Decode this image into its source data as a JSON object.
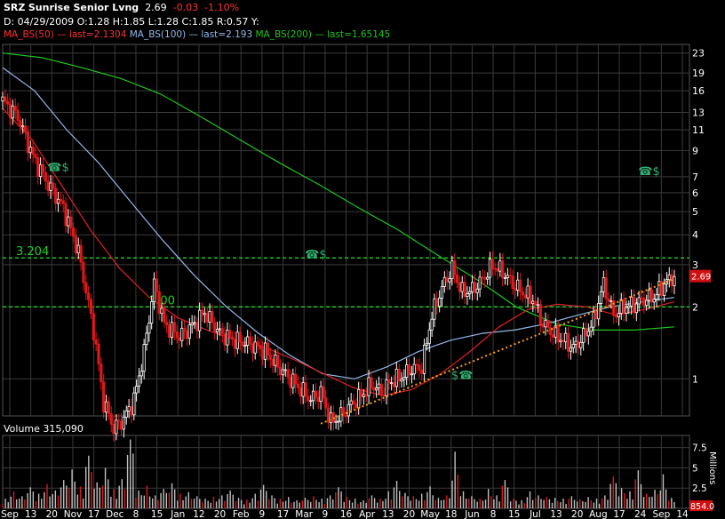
{
  "header": {
    "symbol": "SRZ",
    "company": "Sunrise Senior Lvng",
    "last": "2.69",
    "change": "-0.03",
    "change_pct": "-1.10%",
    "ohlc_line": "D: 04/29/2009 O:1.28 H:1.85 L:1.28 C:1.85 R:0.57 Y:",
    "ma50": {
      "label": "MA_BS(50)",
      "last": "last=2.1304",
      "color": "#e02020"
    },
    "ma100": {
      "label": "MA_BS(100)",
      "last": "last=2.193",
      "color": "#8fb8e8"
    },
    "ma200": {
      "label": "MA_BS(200)",
      "last": "last=1.65145",
      "color": "#1fc41f"
    }
  },
  "volume_label": "Volume 315,090",
  "millions_label": "Millions",
  "chart_data": {
    "type": "candlestick",
    "price_scale": "log",
    "price_ticks": [
      1,
      2,
      3,
      4,
      5,
      6,
      7,
      9,
      11,
      13,
      16,
      19,
      23
    ],
    "price_range": [
      0.7,
      25
    ],
    "x_ticks": [
      "Sep",
      "13",
      "20",
      "Nov",
      "17",
      "Dec",
      "8",
      "15",
      "Jan",
      "12",
      "20",
      "Feb",
      "9",
      "17",
      "Mar",
      "9",
      "16",
      "Apr",
      "13",
      "20",
      "May",
      "18",
      "Jun",
      "8",
      "15",
      "Jul",
      "13",
      "20",
      "Aug",
      "17",
      "24",
      "Sep",
      "14"
    ],
    "close_series": [
      {
        "t": 0,
        "p": 14.5
      },
      {
        "t": 3,
        "p": 12.5
      },
      {
        "t": 6,
        "p": 8.5
      },
      {
        "t": 9,
        "p": 6.5
      },
      {
        "t": 12,
        "p": 5.2
      },
      {
        "t": 15,
        "p": 3.4
      },
      {
        "t": 18,
        "p": 1.6
      },
      {
        "t": 20,
        "p": 0.8
      },
      {
        "t": 22,
        "p": 0.62
      },
      {
        "t": 24,
        "p": 0.68
      },
      {
        "t": 26,
        "p": 0.82
      },
      {
        "t": 28,
        "p": 1.3
      },
      {
        "t": 30,
        "p": 2.5
      },
      {
        "t": 32,
        "p": 1.7
      },
      {
        "t": 35,
        "p": 1.5
      },
      {
        "t": 38,
        "p": 1.7
      },
      {
        "t": 40,
        "p": 1.9
      },
      {
        "t": 43,
        "p": 1.55
      },
      {
        "t": 46,
        "p": 1.45
      },
      {
        "t": 49,
        "p": 1.4
      },
      {
        "t": 52,
        "p": 1.3
      },
      {
        "t": 55,
        "p": 1.1
      },
      {
        "t": 58,
        "p": 0.95
      },
      {
        "t": 61,
        "p": 0.82
      },
      {
        "t": 63,
        "p": 0.88
      },
      {
        "t": 65,
        "p": 0.66
      },
      {
        "t": 67,
        "p": 0.7
      },
      {
        "t": 69,
        "p": 0.78
      },
      {
        "t": 71,
        "p": 0.85
      },
      {
        "t": 73,
        "p": 0.95
      },
      {
        "t": 75,
        "p": 0.88
      },
      {
        "t": 77,
        "p": 0.98
      },
      {
        "t": 79,
        "p": 1.02
      },
      {
        "t": 81,
        "p": 1.1
      },
      {
        "t": 83,
        "p": 1.12
      },
      {
        "t": 85,
        "p": 1.85
      },
      {
        "t": 87,
        "p": 2.4
      },
      {
        "t": 89,
        "p": 2.9
      },
      {
        "t": 91,
        "p": 2.3
      },
      {
        "t": 93,
        "p": 2.35
      },
      {
        "t": 95,
        "p": 2.6
      },
      {
        "t": 97,
        "p": 3.0
      },
      {
        "t": 99,
        "p": 2.8
      },
      {
        "t": 101,
        "p": 2.5
      },
      {
        "t": 103,
        "p": 2.3
      },
      {
        "t": 105,
        "p": 2.15
      },
      {
        "t": 107,
        "p": 1.7
      },
      {
        "t": 109,
        "p": 1.55
      },
      {
        "t": 111,
        "p": 1.45
      },
      {
        "t": 113,
        "p": 1.35
      },
      {
        "t": 115,
        "p": 1.5
      },
      {
        "t": 117,
        "p": 1.75
      },
      {
        "t": 119,
        "p": 2.5
      },
      {
        "t": 121,
        "p": 1.85
      },
      {
        "t": 123,
        "p": 2.0
      },
      {
        "t": 125,
        "p": 2.05
      },
      {
        "t": 127,
        "p": 2.15
      },
      {
        "t": 129,
        "p": 2.2
      },
      {
        "t": 131,
        "p": 2.5
      },
      {
        "t": 133,
        "p": 2.69
      }
    ],
    "ma50_series": [
      13.5,
      10,
      6.5,
      4.2,
      2.9,
      2.2,
      1.8,
      1.6,
      1.45,
      1.35,
      1.2,
      1.05,
      0.92,
      0.85,
      0.9,
      1.05,
      1.3,
      1.65,
      1.95,
      2.05,
      2.0,
      1.85,
      1.95,
      2.1
    ],
    "ma100_series": [
      20,
      16,
      11,
      8,
      5.5,
      3.8,
      2.7,
      2.0,
      1.55,
      1.25,
      1.05,
      1.0,
      1.12,
      1.3,
      1.45,
      1.55,
      1.6,
      1.7,
      1.85,
      2.0,
      2.1,
      2.19
    ],
    "ma200_series": [
      23,
      22,
      20,
      18,
      15.5,
      12.5,
      10,
      8,
      6.5,
      5.2,
      4.2,
      3.3,
      2.6,
      2.0,
      1.7,
      1.6,
      1.6,
      1.65
    ],
    "horizontal_lines": [
      {
        "value": 3.204,
        "label": "3.204"
      },
      {
        "value": 2.0,
        "label": "2.00"
      }
    ],
    "trendline": {
      "from": {
        "t": 63,
        "p": 0.65
      },
      "to": {
        "t": 133,
        "p": 2.62
      }
    },
    "last_price_badge": "2.69",
    "volume_ticks": [
      "2.5",
      "5",
      "7.5"
    ],
    "volume_range": [
      0,
      9
    ],
    "volume_last_badge": "854.0",
    "volume_millions": [
      1.2,
      2.1,
      1.5,
      2.6,
      1.8,
      3.0,
      2.2,
      3.5,
      4.8,
      2.7,
      6.5,
      3.2,
      5.0,
      2.4,
      3.6,
      8.5,
      2.2,
      2.8,
      1.6,
      2.4,
      3.1,
      1.8,
      2.0,
      1.5,
      1.2,
      1.4,
      1.6,
      2.2,
      1.3,
      1.1,
      1.8,
      2.9,
      1.6,
      1.2,
      1.4,
      1.0,
      1.3,
      1.5,
      1.2,
      1.6,
      2.6,
      1.4,
      1.2,
      1.0,
      1.6,
      1.2,
      2.1,
      3.4,
      1.9,
      1.5,
      1.8,
      2.7,
      1.3,
      1.6,
      7.0,
      2.1,
      1.5,
      1.2,
      2.4,
      1.6,
      3.5,
      1.2,
      1.0,
      2.1,
      1.6,
      1.4,
      1.3,
      1.2,
      1.5,
      1.1,
      1.4,
      1.2,
      1.6,
      3.9,
      2.5,
      2.1,
      4.7,
      1.8,
      2.3,
      4.2,
      1.3
    ],
    "events": [
      {
        "t": 11,
        "p": 7.4,
        "glyph": "☎$"
      },
      {
        "t": 62,
        "p": 3.2,
        "glyph": "☎$"
      },
      {
        "t": 91,
        "p": 1.0,
        "glyph": "$☎"
      },
      {
        "t": 128,
        "p": 7.1,
        "glyph": "☎$"
      }
    ]
  }
}
